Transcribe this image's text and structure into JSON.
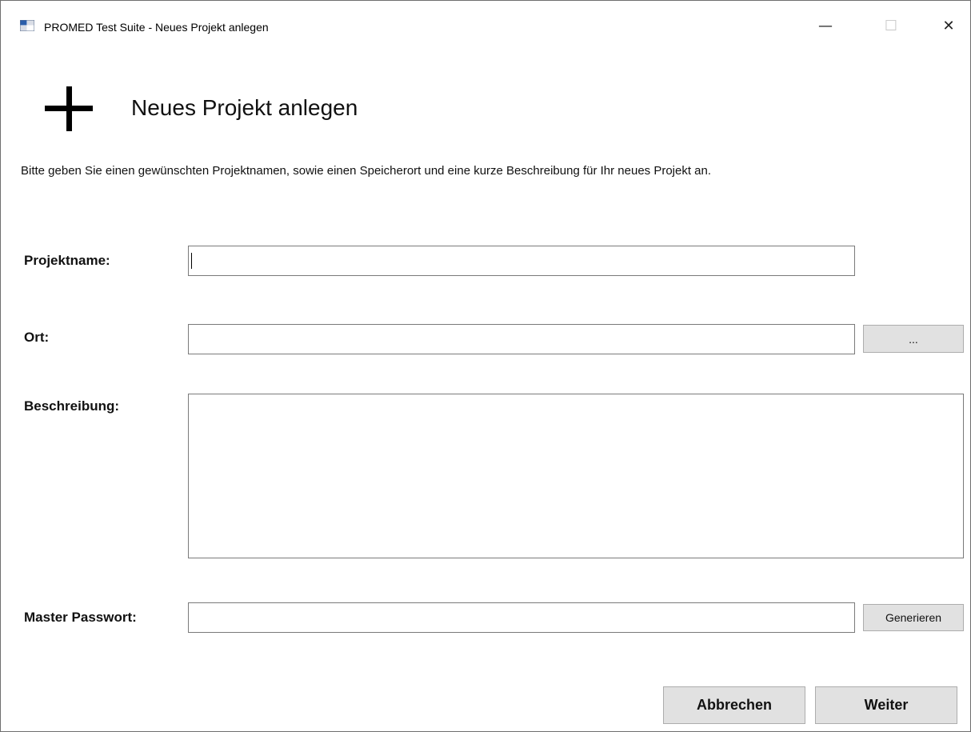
{
  "window": {
    "title": "PROMED Test Suite - Neues Projekt anlegen",
    "controls": {
      "minimize": "—",
      "maximize": "☐",
      "close": "✕"
    }
  },
  "header": {
    "icon": "plus-icon",
    "title": "Neues Projekt anlegen",
    "description": "Bitte geben Sie einen gewünschten Projektnamen, sowie einen Speicherort und eine kurze Beschreibung für Ihr neues Projekt an."
  },
  "form": {
    "project_name": {
      "label": "Projektname:",
      "value": ""
    },
    "location": {
      "label": "Ort:",
      "value": "",
      "browse_label": "..."
    },
    "description": {
      "label": "Beschreibung:",
      "value": ""
    },
    "master_password": {
      "label": "Master Passwort:",
      "value": "",
      "generate_label": "Generieren"
    }
  },
  "footer": {
    "cancel_label": "Abbrechen",
    "next_label": "Weiter"
  }
}
